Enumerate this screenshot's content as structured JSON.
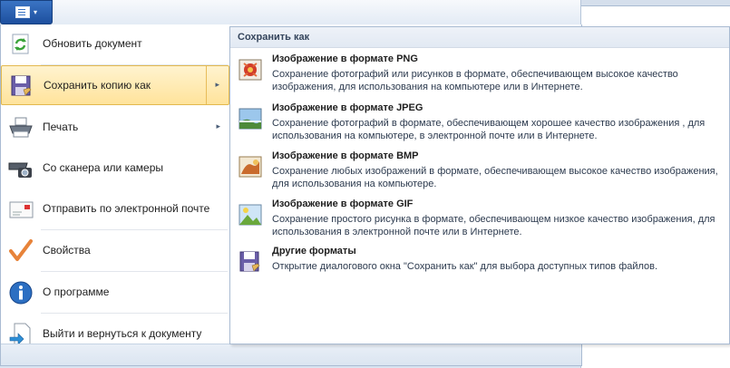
{
  "app_button": {
    "icon": "menu-icon",
    "caret": "▾"
  },
  "menu": {
    "items": [
      {
        "label": "Обновить документ",
        "icon": "refresh-icon"
      },
      {
        "label": "Сохранить копию как",
        "icon": "save-icon",
        "arrow": "▸"
      },
      {
        "label": "Печать",
        "icon": "printer-icon",
        "arrow": "▸"
      },
      {
        "label": "Со сканера или камеры",
        "icon": "scanner-camera-icon"
      },
      {
        "label": "Отправить по электронной почте",
        "icon": "email-icon"
      },
      {
        "label": "Свойства",
        "icon": "checkmark-icon"
      },
      {
        "label": "О программе",
        "icon": "info-icon"
      },
      {
        "label": "Выйти и вернуться к документу",
        "icon": "exit-icon"
      }
    ]
  },
  "submenu": {
    "header": "Сохранить как",
    "options": [
      {
        "title": "Изображение в формате PNG",
        "desc": "Сохранение фотографий или рисунков в формате, обеспечивающем высокое качество изображения, для использования на компьютере или в Интернете.",
        "icon": "png-image-icon"
      },
      {
        "title": "Изображение в формате JPEG",
        "desc": "Сохранение фотографий в формате, обеспечивающем хорошее качество изображения , для использования на компьютере, в электронной почте или в Интернете.",
        "icon": "jpeg-image-icon"
      },
      {
        "title": "Изображение в формате BMP",
        "desc": "Сохранение любых изображений в формате, обеспечивающем высокое качество изображения, для использования на компьютере.",
        "icon": "bmp-image-icon"
      },
      {
        "title": "Изображение в формате GIF",
        "desc": "Сохранение простого рисунка в формате, обеспечивающем низкое качество изображения, для использования в электронной почте или в Интернете.",
        "icon": "gif-image-icon"
      },
      {
        "title": "Другие форматы",
        "desc": "Открытие диалогового окна \"Сохранить как\" для выбора доступных типов файлов.",
        "icon": "save-other-icon"
      }
    ]
  }
}
